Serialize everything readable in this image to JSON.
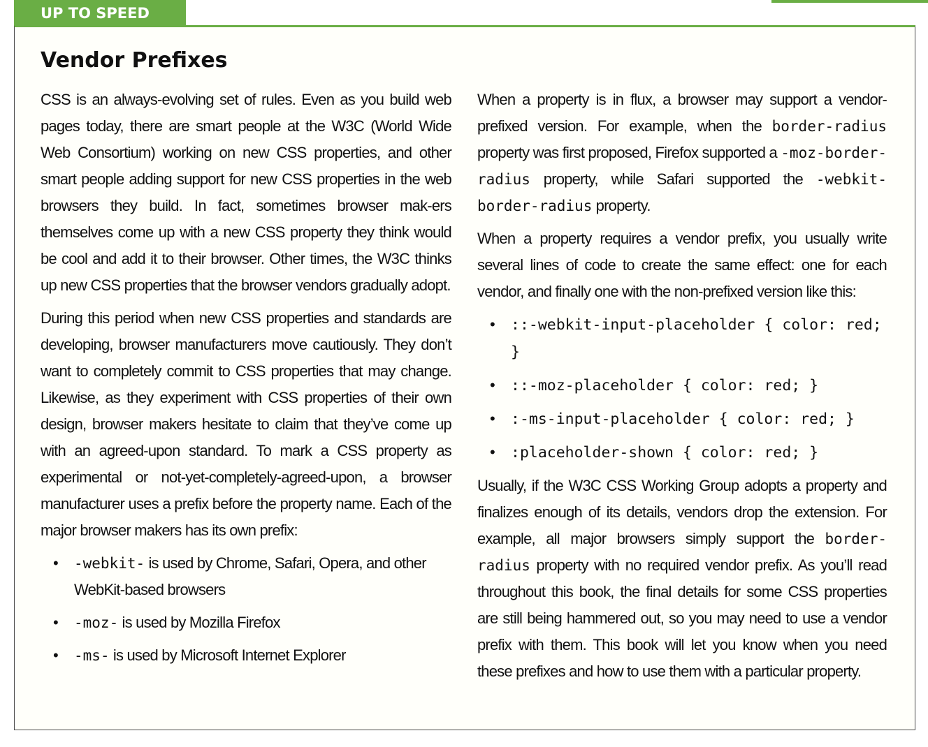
{
  "sidebar_label": "UP TO SPEED",
  "title": "Vendor Prefixes",
  "accent_color": "#6aae45",
  "left": {
    "p1": "CSS is an always-evolving set of rules. Even as you build web pages today, there are smart people at the W3C (World Wide Web Consortium) working on new CSS properties, and other smart people adding support for new CSS properties in the web browsers they build. In fact, sometimes browser mak-ers themselves come up with a new CSS property they think would be cool and add it to their browser. Other times, the W3C thinks up new CSS properties that the browser vendors gradually adopt.",
    "p2": "During this period when new CSS properties and standards are developing, browser manufacturers move cautiously. They don’t want to completely commit to CSS properties that may change. Likewise, as they experiment with CSS properties of their own design, browser makers hesitate to claim that they’ve come up with an agreed-upon standard. To mark a CSS property as experimental or not-yet-completely-agreed-upon, a browser manufacturer uses a prefix before the property name. Each of the major browser makers has its own prefix:",
    "bullets": [
      {
        "code": "-webkit-",
        "text": " is used by Chrome, Safari, Opera, and other WebKit-based browsers"
      },
      {
        "code": "-moz-",
        "text": " is used by Mozilla Firefox"
      },
      {
        "code": "-ms-",
        "text": " is used by Microsoft Internet Explorer"
      }
    ]
  },
  "right": {
    "p1a": "When a property is in flux, a browser may support a vendor-prefixed version. For example, when the ",
    "p1_code1": "border-radius",
    "p1b": " property was first proposed, Firefox supported a ",
    "p1_code2": "-moz-border-radius",
    "p1c": " property, while Safari supported the ",
    "p1_code3": "-webkit-border-radius",
    "p1d": " property.",
    "p2": "When a property requires a vendor prefix, you usually write several lines of code to create the same effect: one for each vendor, and finally one with the non-prefixed version like this:",
    "code_bullets": [
      "::-webkit-input-placeholder { color: red; }",
      "::-moz-placeholder { color: red; }",
      ":-ms-input-placeholder { color: red; }",
      ":placeholder-shown { color: red; }"
    ],
    "p3a": "Usually, if the W3C CSS Working Group adopts a property and finalizes enough of its details, vendors drop the extension. For example, all major browsers simply support the ",
    "p3_code": "border-radius",
    "p3b": " property with no required vendor prefix. As you’ll read throughout this book, the final details for some CSS properties are still being hammered out, so you may need to use a vendor prefix with them. This book will let you know when you need these prefixes and how to use them with a particular property."
  },
  "bullet_glyph": "•"
}
